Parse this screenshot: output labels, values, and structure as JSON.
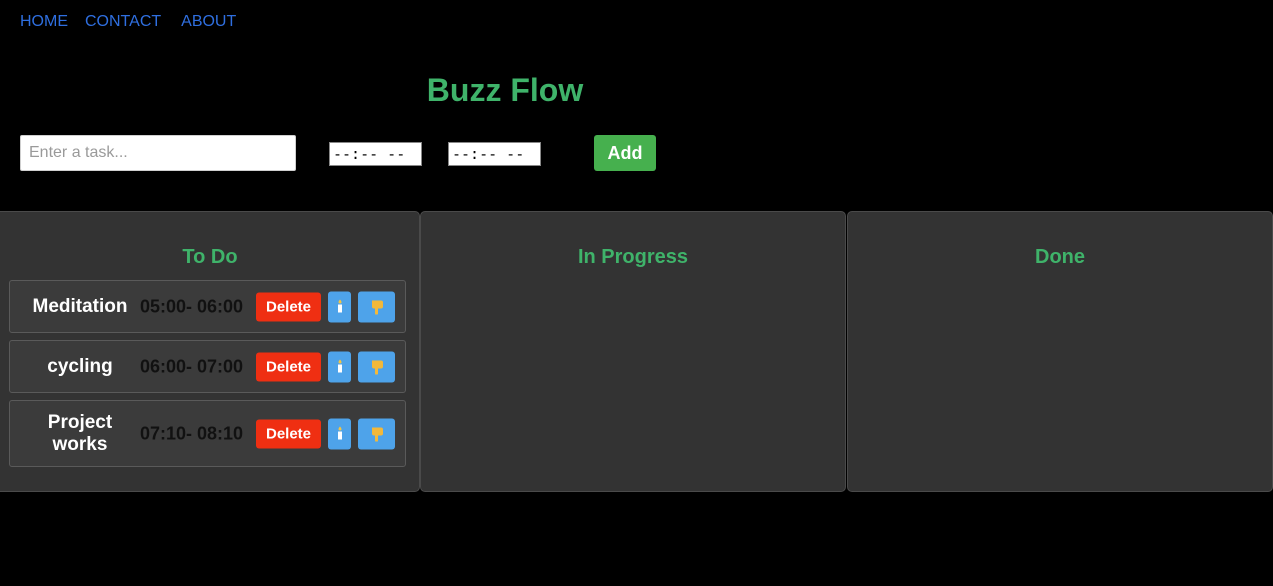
{
  "nav": {
    "home": "HOME",
    "contact": "CONTACT",
    "about": "ABOUT"
  },
  "app": {
    "title": "Buzz Flow"
  },
  "form": {
    "task_placeholder": "Enter a task...",
    "task_value": "",
    "start_time_display": "--:-- --",
    "end_time_display": "--:-- --",
    "add_label": "Add"
  },
  "columns": {
    "todo": {
      "title": "To Do"
    },
    "in_progress": {
      "title": "In Progress"
    },
    "done": {
      "title": "Done"
    }
  },
  "tasks": [
    {
      "name": "Meditation",
      "times": "05:00- 06:00",
      "delete_label": "Delete",
      "move_icon": "candle-icon",
      "pick_icon": "hand-pointing-down-icon"
    },
    {
      "name": "cycling",
      "times": "06:00- 07:00",
      "delete_label": "Delete",
      "move_icon": "candle-icon",
      "pick_icon": "hand-pointing-down-icon"
    },
    {
      "name": "Project works",
      "times": "07:10- 08:10",
      "delete_label": "Delete",
      "move_icon": "candle-icon",
      "pick_icon": "hand-pointing-down-icon"
    }
  ],
  "colors": {
    "accent_green": "#3fb36a",
    "add_button": "#46b04e",
    "delete_button": "#ef2f12",
    "action_button": "#4ea3ea",
    "nav_link": "#2f6fe0",
    "column_bg": "#333333"
  }
}
